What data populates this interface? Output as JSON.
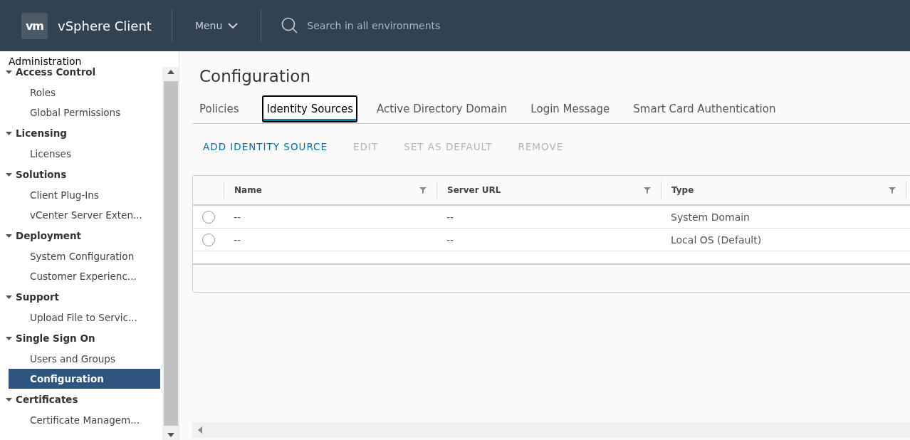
{
  "header": {
    "logo": "vm",
    "title": "vSphere Client",
    "menu": "Menu",
    "search": {
      "placeholder": "Search in all environments"
    }
  },
  "sidebar": {
    "title": "Administration",
    "groups": [
      {
        "label": "Access Control",
        "expanded": true,
        "items": [
          {
            "label": "Roles",
            "selected": false
          },
          {
            "label": "Global Permissions",
            "selected": false
          }
        ]
      },
      {
        "label": "Licensing",
        "expanded": true,
        "items": [
          {
            "label": "Licenses",
            "selected": false
          }
        ]
      },
      {
        "label": "Solutions",
        "expanded": true,
        "items": [
          {
            "label": "Client Plug-Ins",
            "selected": false
          },
          {
            "label": "vCenter Server Exten...",
            "selected": false
          }
        ]
      },
      {
        "label": "Deployment",
        "expanded": true,
        "items": [
          {
            "label": "System Configuration",
            "selected": false
          },
          {
            "label": "Customer Experienc...",
            "selected": false
          }
        ]
      },
      {
        "label": "Support",
        "expanded": true,
        "items": [
          {
            "label": "Upload File to Servic...",
            "selected": false
          }
        ]
      },
      {
        "label": "Single Sign On",
        "expanded": true,
        "items": [
          {
            "label": "Users and Groups",
            "selected": false
          },
          {
            "label": "Configuration",
            "selected": true
          }
        ]
      },
      {
        "label": "Certificates",
        "expanded": true,
        "items": [
          {
            "label": "Certificate Managem...",
            "selected": false
          }
        ]
      }
    ]
  },
  "page": {
    "title": "Configuration",
    "tabs": [
      {
        "label": "Policies",
        "selected": false
      },
      {
        "label": "Identity Sources",
        "selected": true
      },
      {
        "label": "Active Directory Domain",
        "selected": false
      },
      {
        "label": "Login Message",
        "selected": false
      },
      {
        "label": "Smart Card Authentication",
        "selected": false
      }
    ],
    "actions": [
      {
        "label": "ADD IDENTITY SOURCE",
        "disabled": false
      },
      {
        "label": "EDIT",
        "disabled": true
      },
      {
        "label": "SET AS DEFAULT",
        "disabled": true
      },
      {
        "label": "REMOVE",
        "disabled": true
      }
    ],
    "table": {
      "columns": [
        "Name",
        "Server URL",
        "Type"
      ],
      "rows": [
        {
          "selected": false,
          "cells": [
            "--",
            "--",
            "System Domain"
          ]
        },
        {
          "selected": false,
          "cells": [
            "--",
            "--",
            "Local OS (Default)"
          ]
        }
      ]
    }
  }
}
